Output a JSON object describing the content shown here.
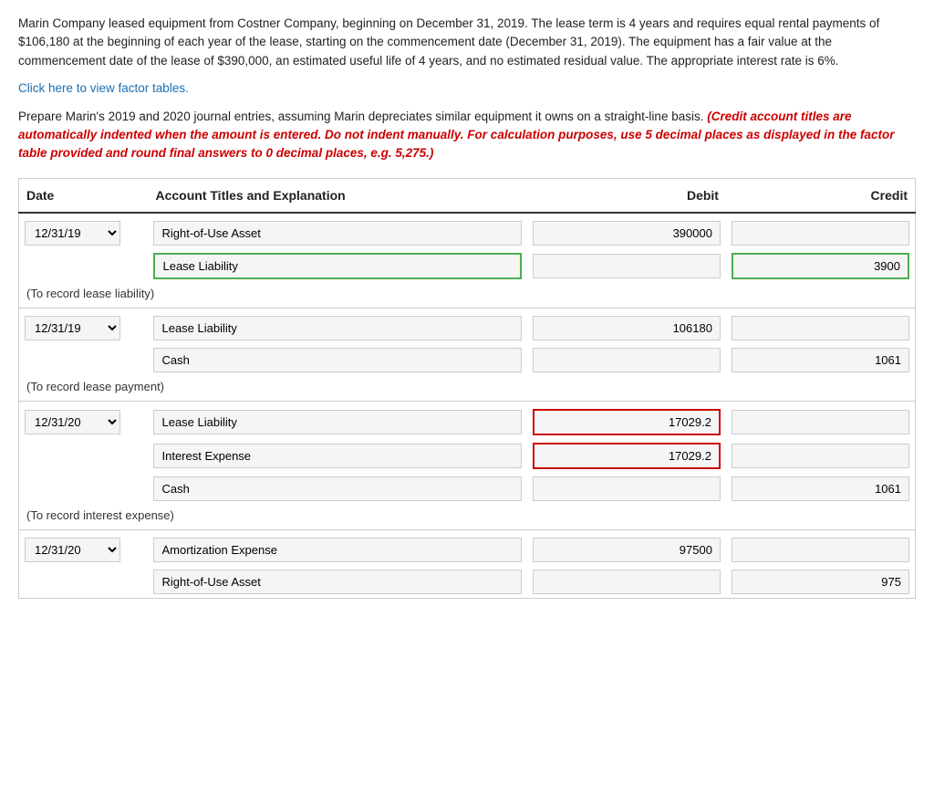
{
  "problem": {
    "text": "Marin Company leased equipment from Costner Company, beginning on December 31, 2019. The lease term is 4 years and requires equal rental payments of $106,180 at the beginning of each year of the lease, starting on the commencement date (December 31, 2019). The equipment has a fair value at the commencement date of the lease of $390,000, an estimated useful life of 4 years, and no estimated residual value. The appropriate interest rate is 6%.",
    "link": "Click here to view factor tables.",
    "instruction_prefix": "Prepare Marin's 2019 and 2020 journal entries, assuming Marin depreciates similar equipment it owns on a straight-line basis.",
    "instruction_italic": "(Credit account titles are automatically indented when the amount is entered. Do not indent manually. For calculation purposes, use 5 decimal places as displayed in the factor table provided and round final answers to 0 decimal places, e.g. 5,275.)"
  },
  "table": {
    "headers": {
      "date": "Date",
      "account": "Account Titles and Explanation",
      "debit": "Debit",
      "credit": "Credit"
    },
    "entries": [
      {
        "id": "entry1",
        "date": "12/31/19",
        "rows": [
          {
            "account": "Right-of-Use Asset",
            "account_style": "normal",
            "debit": "390000",
            "debit_style": "normal",
            "credit": "",
            "credit_style": "normal"
          },
          {
            "account": "Lease Liability",
            "account_style": "green",
            "debit": "",
            "debit_style": "normal",
            "credit": "3900",
            "credit_style": "green",
            "credit_truncated": true
          }
        ],
        "note": "(To record lease liability)"
      },
      {
        "id": "entry2",
        "date": "12/31/19",
        "rows": [
          {
            "account": "Lease Liability",
            "account_style": "normal",
            "debit": "106180",
            "debit_style": "normal",
            "credit": "",
            "credit_style": "normal"
          },
          {
            "account": "Cash",
            "account_style": "normal",
            "debit": "",
            "debit_style": "normal",
            "credit": "1061",
            "credit_style": "normal",
            "credit_truncated": true
          }
        ],
        "note": "(To record lease payment)"
      },
      {
        "id": "entry3",
        "date": "12/31/20",
        "rows": [
          {
            "account": "Lease Liability",
            "account_style": "normal",
            "debit": "17029.2",
            "debit_style": "red",
            "credit": "",
            "credit_style": "normal"
          },
          {
            "account": "Interest Expense",
            "account_style": "normal",
            "debit": "17029.2",
            "debit_style": "red",
            "credit": "",
            "credit_style": "normal"
          },
          {
            "account": "Cash",
            "account_style": "normal",
            "debit": "",
            "debit_style": "normal",
            "credit": "1061",
            "credit_style": "normal",
            "credit_truncated": true
          }
        ],
        "note": "(To record interest expense)"
      },
      {
        "id": "entry4",
        "date": "12/31/20",
        "rows": [
          {
            "account": "Amortization Expense",
            "account_style": "normal",
            "debit": "97500",
            "debit_style": "normal",
            "credit": "",
            "credit_style": "normal"
          },
          {
            "account": "Right-of-Use Asset",
            "account_style": "normal",
            "debit": "",
            "debit_style": "normal",
            "credit": "975",
            "credit_style": "normal",
            "credit_truncated": true
          }
        ],
        "note": ""
      }
    ]
  }
}
